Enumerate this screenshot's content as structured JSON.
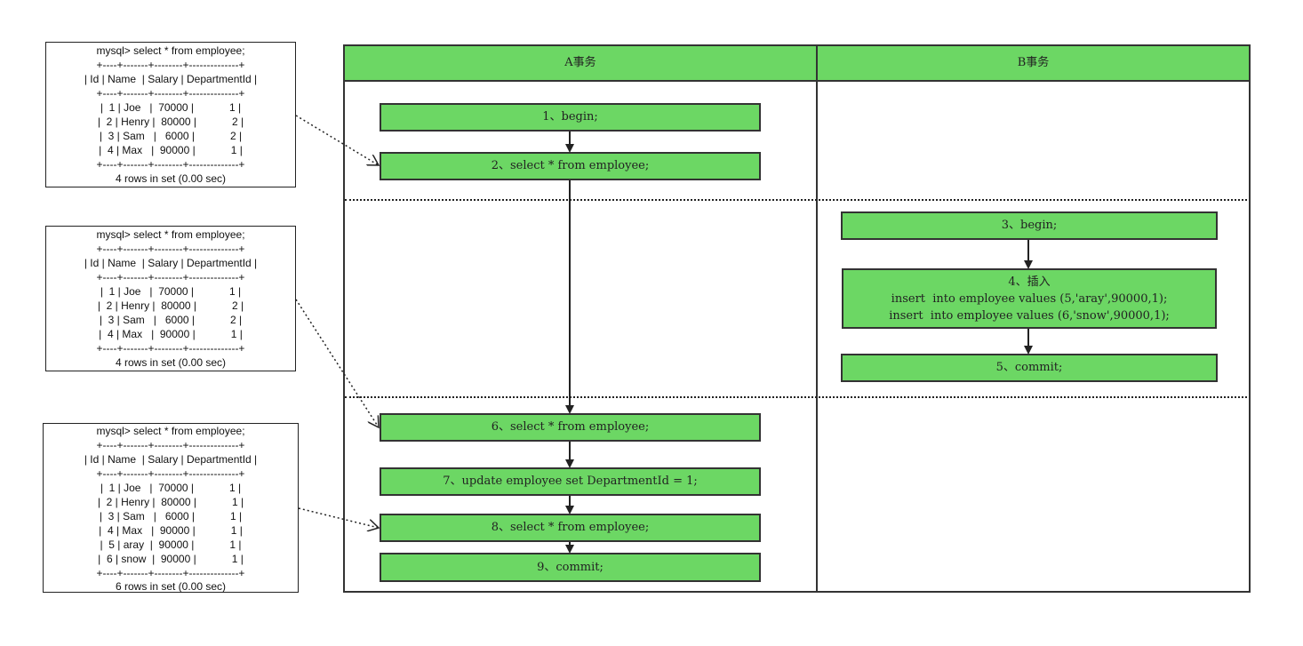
{
  "results": [
    {
      "query": "mysql> select * from employee;",
      "border": "+----+-------+--------+--------------+",
      "header": "| Id | Name  | Salary | DepartmentId |",
      "rows": [
        "|  1 | Joe   |  70000 |            1 |",
        "|  2 | Henry |  80000 |            2 |",
        "|  3 | Sam   |   6000 |            2 |",
        "|  4 | Max   |  90000 |            1 |"
      ],
      "footer": "4 rows in set (0.00 sec)"
    },
    {
      "query": "mysql> select * from employee;",
      "border": "+----+-------+--------+--------------+",
      "header": "| Id | Name  | Salary | DepartmentId |",
      "rows": [
        "|  1 | Joe   |  70000 |            1 |",
        "|  2 | Henry |  80000 |            2 |",
        "|  3 | Sam   |   6000 |            2 |",
        "|  4 | Max   |  90000 |            1 |"
      ],
      "footer": "4 rows in set (0.00 sec)"
    },
    {
      "query": "mysql> select * from employee;",
      "border": "+----+-------+--------+--------------+",
      "header": "| Id | Name  | Salary | DepartmentId |",
      "rows": [
        "|  1 | Joe   |  70000 |            1 |",
        "|  2 | Henry |  80000 |            1 |",
        "|  3 | Sam   |   6000 |            1 |",
        "|  4 | Max   |  90000 |            1 |",
        "|  5 | aray  |  90000 |            1 |",
        "|  6 | snow  |  90000 |            1 |"
      ],
      "footer": "6 rows in set (0.00 sec)"
    }
  ],
  "lanes": {
    "a": "A事务",
    "b": "B事务"
  },
  "steps": {
    "s1": "1、begin;",
    "s2": "2、select * from employee;",
    "s3": "3、begin;",
    "s4_title": "4、插入",
    "s4_line1": "insert  into employee values (5,'aray',90000,1);",
    "s4_line2": "insert  into employee values (6,'snow',90000,1);",
    "s5": "5、commit;",
    "s6": "6、select * from employee;",
    "s7": "7、update employee set DepartmentId = 1;",
    "s8": "8、select * from employee;",
    "s9": "9、commit;"
  },
  "colors": {
    "step_fill": "#6cd764",
    "border": "#333333"
  }
}
